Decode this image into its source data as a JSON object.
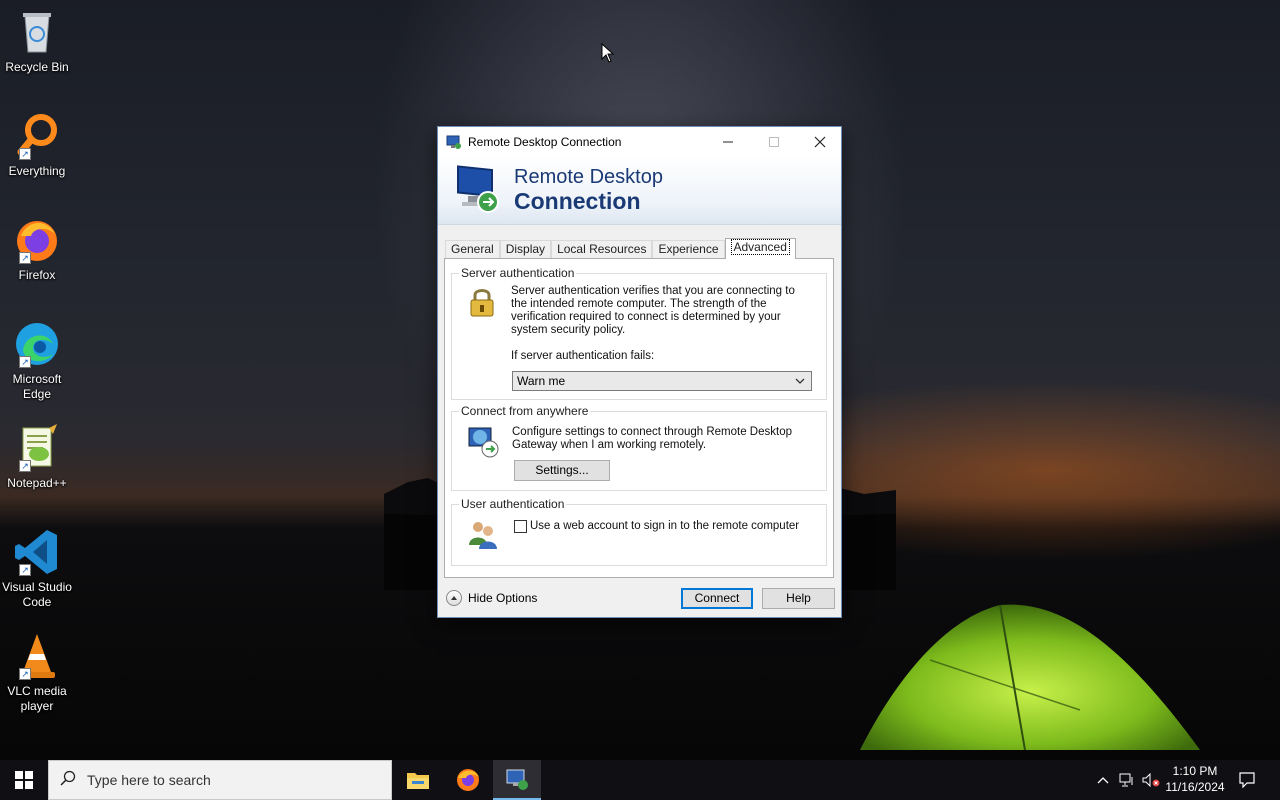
{
  "desktop": {
    "icons": [
      {
        "label": "Recycle Bin",
        "icon": "recycle-bin-icon"
      },
      {
        "label": "Everything",
        "icon": "everything-search-icon"
      },
      {
        "label": "Firefox",
        "icon": "firefox-icon"
      },
      {
        "label": "Microsoft Edge",
        "icon": "edge-icon"
      },
      {
        "label": "Notepad++",
        "icon": "notepad-plus-plus-icon"
      },
      {
        "label": "Visual Studio Code",
        "icon": "vscode-icon"
      },
      {
        "label": "VLC media player",
        "icon": "vlc-icon"
      }
    ]
  },
  "window": {
    "title": "Remote Desktop Connection",
    "banner_line1": "Remote Desktop",
    "banner_line2": "Connection",
    "tabs": [
      "General",
      "Display",
      "Local Resources",
      "Experience",
      "Advanced"
    ],
    "active_tab": "Advanced",
    "server_auth": {
      "legend": "Server authentication",
      "description": "Server authentication verifies that you are connecting to the intended remote computer. The strength of the verification required to connect is determined by your system security policy.",
      "fail_label": "If server authentication fails:",
      "fail_value": "Warn me"
    },
    "connect_anywhere": {
      "legend": "Connect from anywhere",
      "description": "Configure settings to connect through Remote Desktop Gateway when I am working remotely.",
      "settings_button": "Settings..."
    },
    "user_auth": {
      "legend": "User authentication",
      "checkbox_label": "Use a web account to sign in to the remote computer",
      "checked": false
    },
    "hide_options": "Hide Options",
    "connect_button": "Connect",
    "help_button": "Help"
  },
  "taskbar": {
    "search_placeholder": "Type here to search",
    "time": "1:10 PM",
    "date": "11/16/2024",
    "pinned": [
      "file-explorer-icon",
      "firefox-icon",
      "remote-desktop-icon"
    ]
  }
}
